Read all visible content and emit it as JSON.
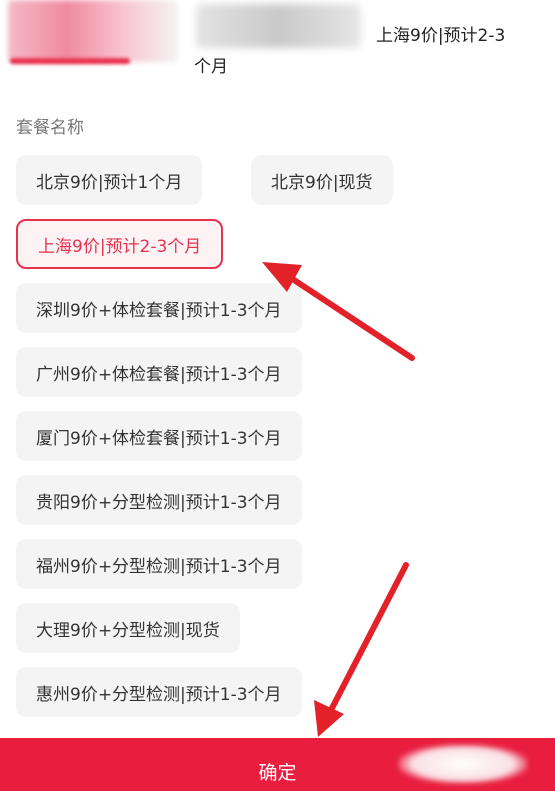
{
  "header": {
    "selected_summary": "上海9价|预计2-3",
    "summary_suffix": "个月"
  },
  "section_label": "套餐名称",
  "options": [
    {
      "label": "北京9价|预计1个月",
      "selected": false
    },
    {
      "label": "北京9价|现货",
      "selected": false
    },
    {
      "label": "上海9价|预计2-3个月",
      "selected": true
    },
    {
      "label": "深圳9价+体检套餐|预计1-3个月",
      "selected": false
    },
    {
      "label": "广州9价+体检套餐|预计1-3个月",
      "selected": false
    },
    {
      "label": "厦门9价+体检套餐|预计1-3个月",
      "selected": false
    },
    {
      "label": "贵阳9价+分型检测|预计1-3个月",
      "selected": false
    },
    {
      "label": "福州9价+分型检测|预计1-3个月",
      "selected": false
    },
    {
      "label": "大理9价+分型检测|现货",
      "selected": false
    },
    {
      "label": "惠州9价+分型检测|预计1-3个月",
      "selected": false
    }
  ],
  "confirm_label": "确定",
  "colors": {
    "accent": "#e91e3f",
    "annotation_arrow": "#e32128"
  }
}
